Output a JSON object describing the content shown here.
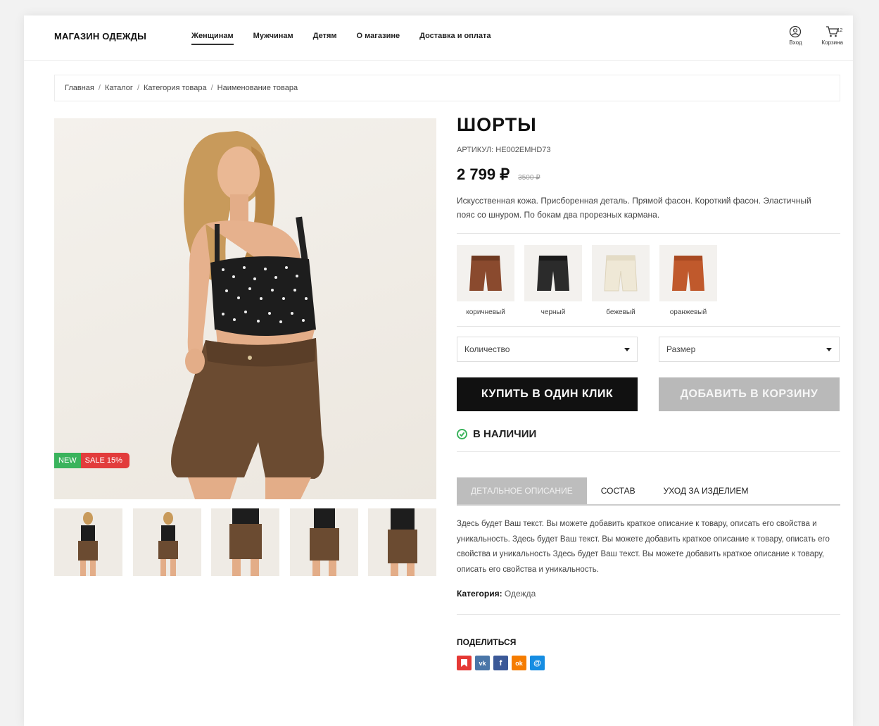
{
  "header": {
    "logo": "МАГАЗИН ОДЕЖДЫ",
    "nav": [
      "Женщинам",
      "Мужчинам",
      "Детям",
      "О магазине",
      "Доставка и оплата"
    ],
    "login_label": "Вход",
    "cart_label": "Корзина",
    "cart_count": "12"
  },
  "breadcrumb": [
    "Главная",
    "Каталог",
    "Категория товара",
    "Наименование товара"
  ],
  "product": {
    "title": "ШОРТЫ",
    "sku": "АРТИКУЛ: HE002EMHD73",
    "price": "2 799 ₽",
    "old_price": "3500 ₽",
    "description": "Искусственная кожа. Присборенная деталь. Прямой фасон. Короткий фасон. Эластичный пояс со шнуром. По бокам два прорезных кармана.",
    "badges": {
      "new": "NEW",
      "sale": "SALE 15%"
    },
    "colors": [
      {
        "label": "коричневый",
        "hex": "#8a4a2e"
      },
      {
        "label": "черный",
        "hex": "#2b2b2b"
      },
      {
        "label": "бежевый",
        "hex": "#efe8d6"
      },
      {
        "label": "оранжевый",
        "hex": "#c0592c"
      }
    ],
    "quantity_label": "Количество",
    "size_label": "Размер",
    "buy_one_click": "КУПИТЬ В ОДИН КЛИК",
    "add_to_cart": "ДОБАВИТЬ В КОРЗИНУ",
    "stock": "В НАЛИЧИИ",
    "stock_color": "#3ab35c"
  },
  "tabs": [
    "ДЕТАЛЬНОЕ ОПИСАНИЕ",
    "СОСТАВ",
    "УХОД ЗА ИЗДЕЛИЕМ"
  ],
  "long_description": "Здесь будет Ваш текст. Вы можете добавить краткое описание к товару, описать его свойства и уникальность. Здесь будет Ваш текст. Вы можете добавить краткое описание к товару, описать его свойства и уникальность Здесь будет Ваш текст. Вы можете добавить краткое описание к товару, описать его свойства и уникальность.",
  "category": {
    "label": "Категория:",
    "value": "Одежда"
  },
  "share": {
    "title": "ПОДЕЛИТЬСЯ",
    "icons": [
      {
        "name": "bookmark-icon",
        "glyph": "▮",
        "color": "#e53935"
      },
      {
        "name": "vk-icon",
        "glyph": "vk",
        "color": "#4a76a8"
      },
      {
        "name": "facebook-icon",
        "glyph": "f",
        "color": "#3b5998"
      },
      {
        "name": "odnoklassniki-icon",
        "glyph": "ok",
        "color": "#f57c00"
      },
      {
        "name": "moimir-icon",
        "glyph": "@",
        "color": "#168de2"
      }
    ]
  }
}
